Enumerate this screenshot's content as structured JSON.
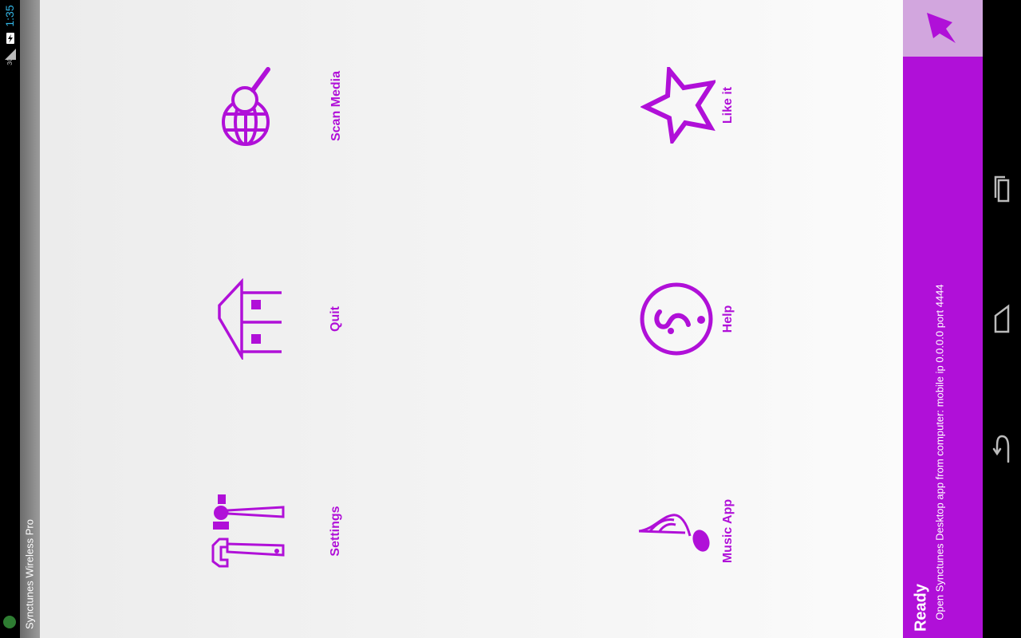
{
  "status_bar": {
    "time": "1:35",
    "network": "3G"
  },
  "app": {
    "title": "Synctunes Wireless Pro"
  },
  "menu": {
    "scan_media": "Scan Media",
    "like_it": "Like it",
    "quit": "Quit",
    "help": "Help",
    "settings": "Settings",
    "music_app": "Music App"
  },
  "panel": {
    "ready": "Ready",
    "info": "Open Synctunes Desktop app from computer: mobile ip 0.0.0.0 port 4444"
  },
  "colors": {
    "accent": "#b010d8",
    "accent_light": "#d2a6de",
    "status_clock": "#33b5e5"
  },
  "icons": {
    "scan": "globe-search-icon",
    "like": "star-icon",
    "quit": "house-icon",
    "help": "question-circle-icon",
    "settings": "tools-icon",
    "music": "music-note-icon"
  }
}
